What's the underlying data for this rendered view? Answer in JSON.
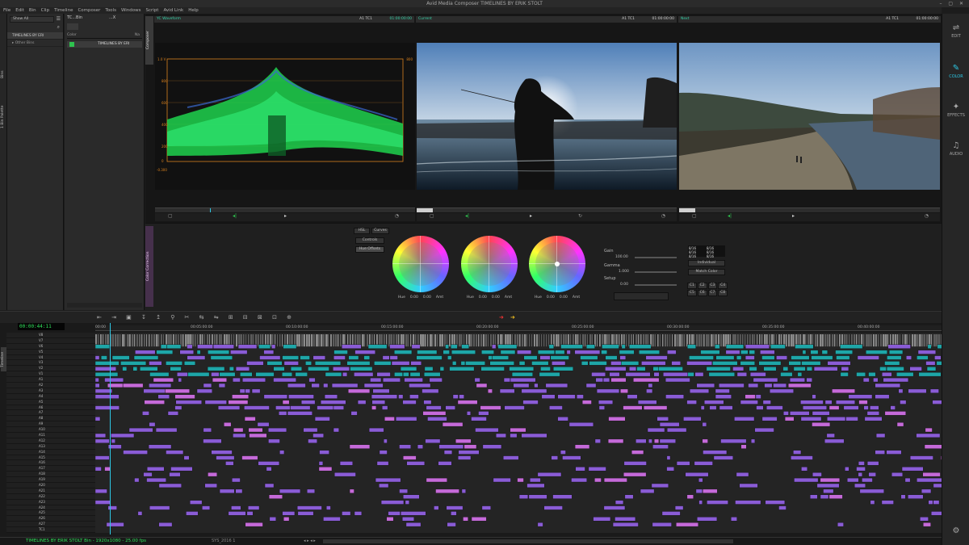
{
  "window": {
    "title": "Avid Media Composer  TIMELINES BY ERIK STOLT",
    "controls": "– ▢ ✕"
  },
  "menu": [
    "File",
    "Edit",
    "Bin",
    "Clip",
    "Timeline",
    "Composer",
    "Tools",
    "Windows",
    "Script",
    "Avid Link",
    "Help"
  ],
  "left_strip": {
    "tabs": [
      "Bins",
      "1 Bin Palette"
    ]
  },
  "bins": {
    "filter": "Show All",
    "items": [
      "TIMELINES BY ERI",
      "Other Bins"
    ]
  },
  "bin2": {
    "title": "TC...Bin",
    "title2": "...X",
    "header_label": "Color",
    "header_right": "Na",
    "item": "TIMELINES BY ERI"
  },
  "composer": {
    "tab": "Composer",
    "panes": [
      {
        "name": "YC Waveform",
        "track": "A1  TC1",
        "tc": "01:00:00:00"
      },
      {
        "name": "Current",
        "track": "A1  TC1",
        "tc": "01:00:00:00"
      },
      {
        "name": "Next",
        "track": "A1  TC1",
        "tc": "01:00:00:00"
      }
    ],
    "waveform_scale": [
      "1.0 V",
      "800",
      "600",
      "400",
      "200",
      "0",
      "-0.300"
    ]
  },
  "color_correction": {
    "tab": "Color Correction",
    "mode_tabs": [
      "HSL",
      "Curves"
    ],
    "sub_buttons": [
      "Controls",
      "Hue Offsets"
    ],
    "wheels": [
      {
        "hue_label": "Hue",
        "hue_value": "0.00",
        "val": "0.00",
        "amt": "Amt"
      },
      {
        "hue_label": "Hue",
        "hue_value": "0.00",
        "val": "0.00",
        "amt": "Amt"
      },
      {
        "hue_label": "Hue",
        "hue_value": "0.00",
        "val": "0.00",
        "amt": "Amt"
      }
    ],
    "levels": [
      {
        "label": "Gain",
        "value": "100.00"
      },
      {
        "label": "Gamma",
        "value": "1.000"
      },
      {
        "label": "Setup",
        "value": "0.00"
      }
    ],
    "preview_values": [
      "8/16",
      "8/16",
      "8/16",
      "8/16",
      "8/16",
      "8/16"
    ],
    "buttons": [
      "Individual",
      "Match Color"
    ],
    "grid_buttons": [
      "C1",
      "C2",
      "C3",
      "C4",
      "C5",
      "C6",
      "C7",
      "C8"
    ]
  },
  "timeline": {
    "timecode": "00:00:44:11",
    "ruler": [
      "00:00",
      "00:05:00:00",
      "00:10:00:00",
      "00:15:00:00",
      "00:20:00:00",
      "00:25:00:00",
      "00:30:00:00",
      "00:35:00:00",
      "00:40:00:00"
    ],
    "bottom_ruler": [
      "00:00",
      "00:05:00:00",
      "00:10:00:00",
      "00:15:00:00",
      "00:20:00:00",
      "00:25:00:00",
      "00:30:00:00",
      "00:35:00:00",
      "00:40:00:00"
    ],
    "tab": "Timeline",
    "tracks": [
      "V8",
      "V7",
      "V6",
      "V5",
      "V4",
      "V3",
      "V2",
      "V1",
      "A1",
      "A2",
      "A3",
      "A4",
      "A5",
      "A6",
      "A7",
      "A8",
      "A9",
      "A10",
      "A11",
      "A12",
      "A13",
      "A14",
      "A15",
      "A16",
      "A17",
      "A18",
      "A19",
      "A20",
      "A21",
      "A22",
      "A23",
      "A24",
      "A25",
      "A26",
      "A27",
      "TC1"
    ],
    "status": "TIMELINES BY ERIK STOLT Bin - 1920x1080 - 25.00 fps",
    "sequence": "SYS_2016 1"
  },
  "right_panel": {
    "tools": [
      {
        "label": "EDIT",
        "icon": "⇌"
      },
      {
        "label": "COLOR",
        "icon": "✎"
      },
      {
        "label": "EFFECTS",
        "icon": "✦"
      },
      {
        "label": "AUDIO",
        "icon": "♫"
      }
    ],
    "settings_icon": "⚙"
  },
  "colors": {
    "accent_teal": "#34d0a6",
    "timecode_green": "#2fe25b",
    "clip_teal": "#1ea6a8",
    "clip_purple": "#8a5cd6",
    "clip_pink": "#c56ad9",
    "playhead": "#2dc7e4"
  }
}
